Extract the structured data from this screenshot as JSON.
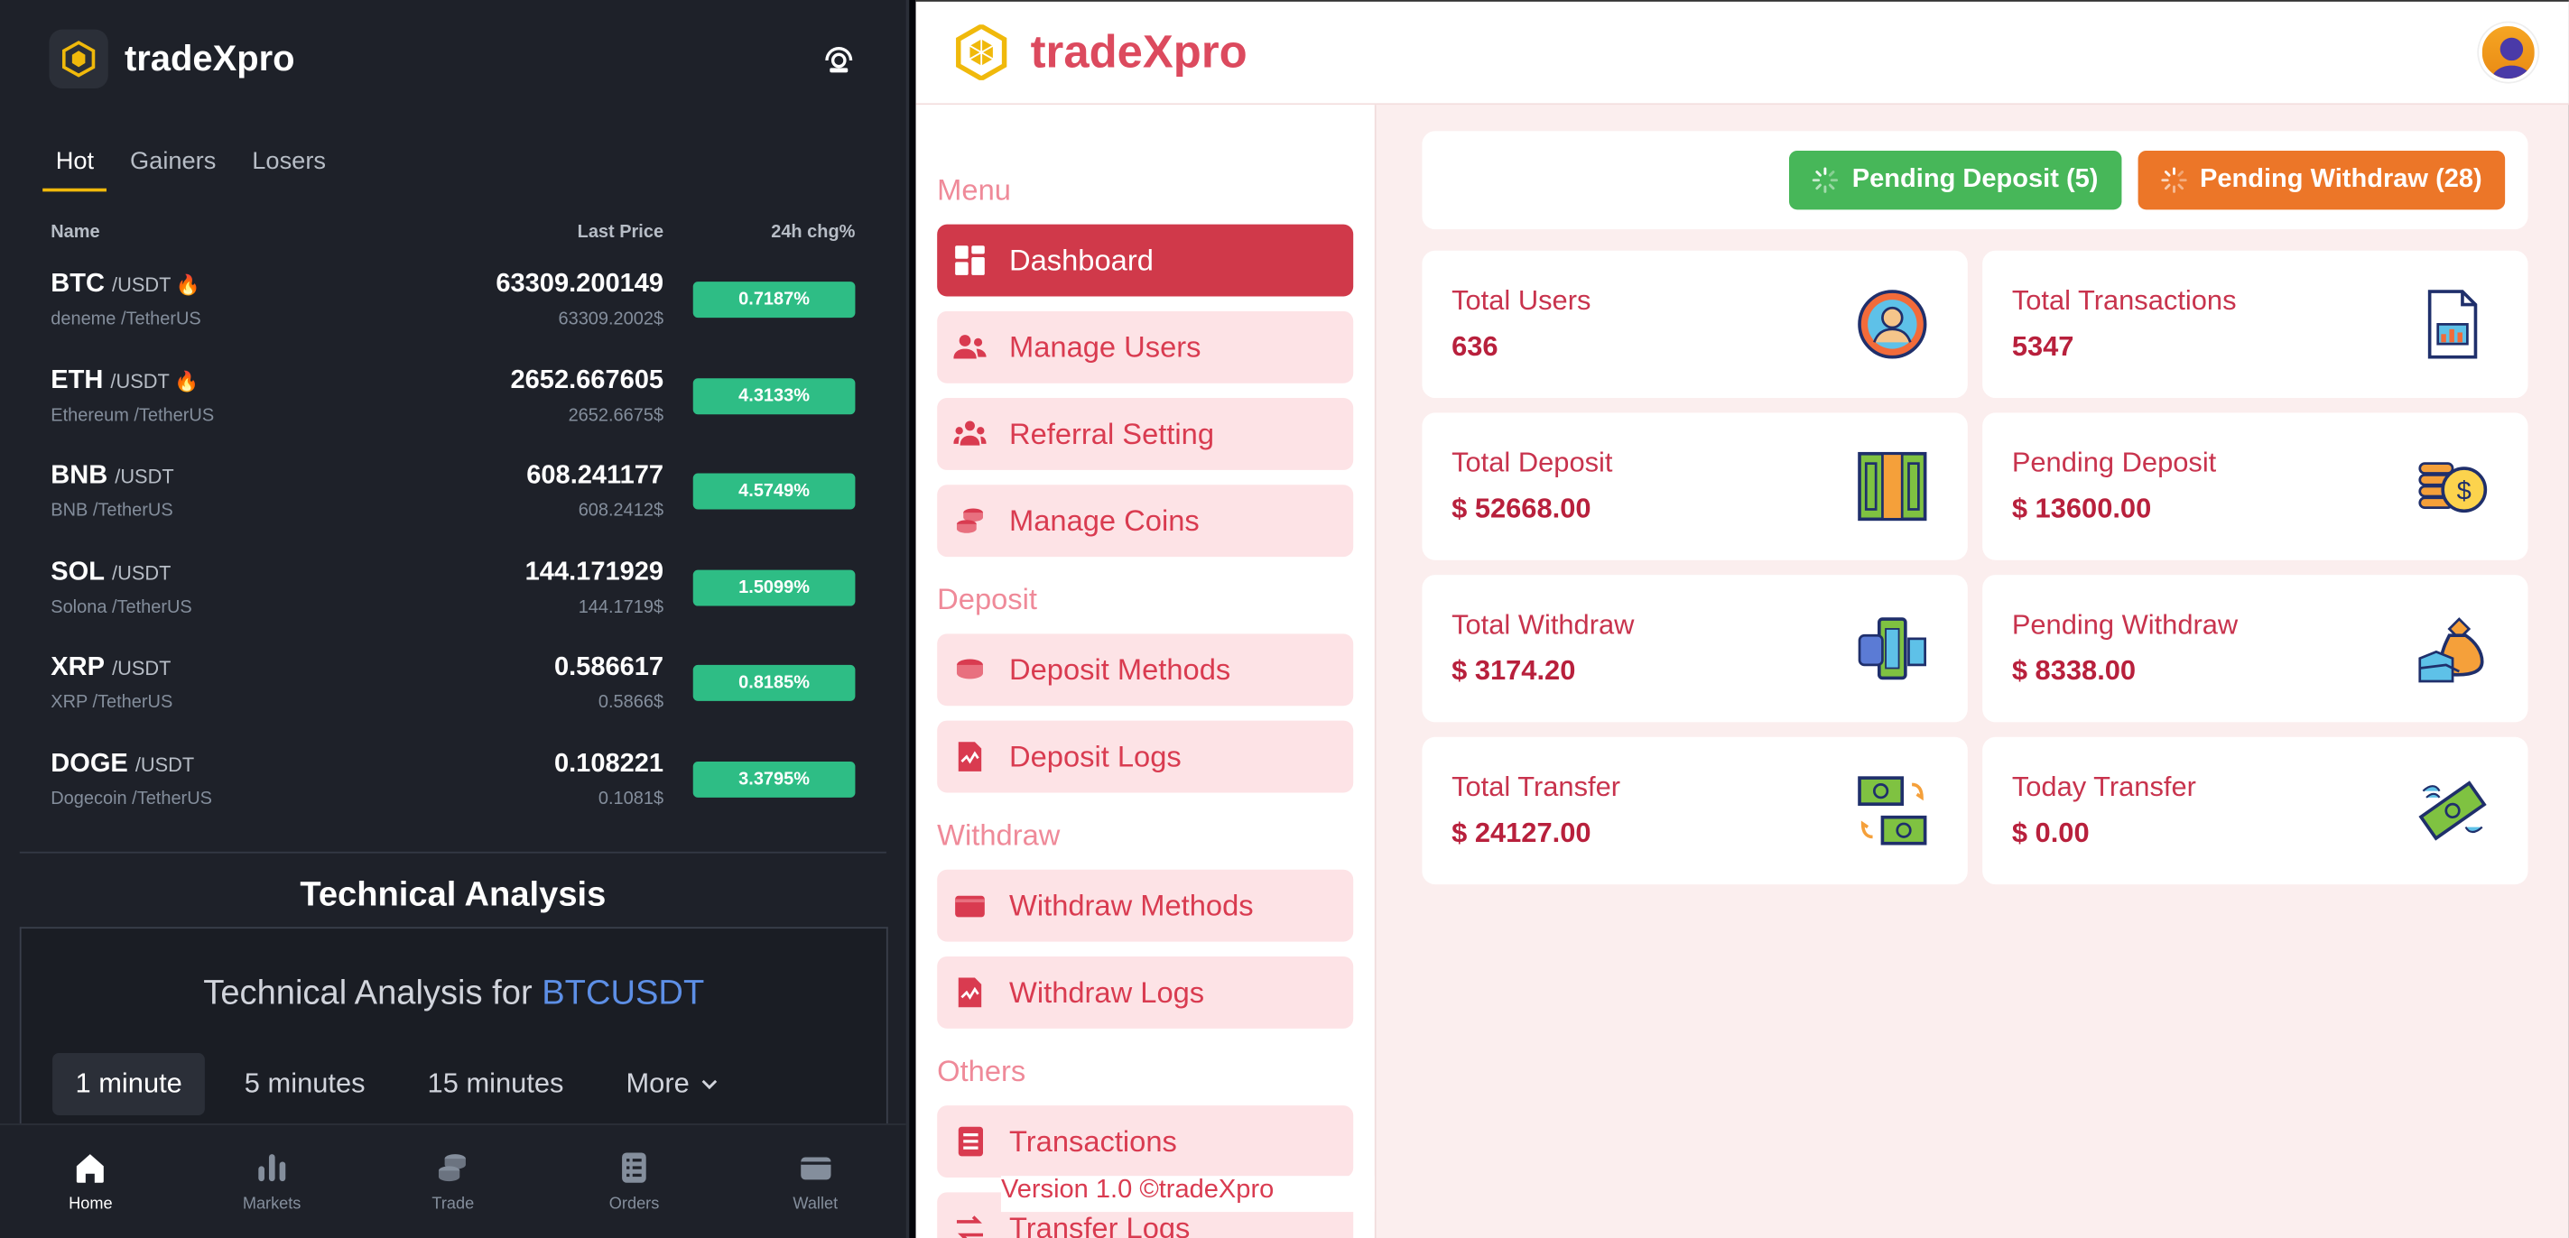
{
  "mobile": {
    "brand": "tradeXpro",
    "tabs": [
      "Hot",
      "Gainers",
      "Losers"
    ],
    "columns": {
      "name": "Name",
      "last_price": "Last Price",
      "change": "24h chg%"
    },
    "coins": [
      {
        "symbol": "BTC",
        "quote": "/USDT",
        "hot": true,
        "subtitle": "deneme /TetherUS",
        "price": "63309.200149",
        "price_sub": "63309.2002$",
        "change": "0.7187%"
      },
      {
        "symbol": "ETH",
        "quote": "/USDT",
        "hot": true,
        "subtitle": "Ethereum /TetherUS",
        "price": "2652.667605",
        "price_sub": "2652.6675$",
        "change": "4.3133%"
      },
      {
        "symbol": "BNB",
        "quote": "/USDT",
        "hot": false,
        "subtitle": "BNB /TetherUS",
        "price": "608.241177",
        "price_sub": "608.2412$",
        "change": "4.5749%"
      },
      {
        "symbol": "SOL",
        "quote": "/USDT",
        "hot": false,
        "subtitle": "Solona /TetherUS",
        "price": "144.171929",
        "price_sub": "144.1719$",
        "change": "1.5099%"
      },
      {
        "symbol": "XRP",
        "quote": "/USDT",
        "hot": false,
        "subtitle": "XRP /TetherUS",
        "price": "0.586617",
        "price_sub": "0.5866$",
        "change": "0.8185%"
      },
      {
        "symbol": "DOGE",
        "quote": "/USDT",
        "hot": false,
        "subtitle": "Dogecoin /TetherUS",
        "price": "0.108221",
        "price_sub": "0.1081$",
        "change": "3.3795%"
      }
    ],
    "technical_analysis": {
      "section_title": "Technical Analysis",
      "heading_prefix": "Technical Analysis for ",
      "pair": "BTCUSDT",
      "intervals": [
        "1 minute",
        "5 minutes",
        "15 minutes"
      ],
      "more": "More"
    },
    "bottom_nav": [
      "Home",
      "Markets",
      "Trade",
      "Orders",
      "Wallet"
    ]
  },
  "admin": {
    "brand": "tradeXpro",
    "sections": {
      "menu": "Menu",
      "deposit": "Deposit",
      "withdraw": "Withdraw",
      "others": "Others"
    },
    "menu": {
      "dashboard": "Dashboard",
      "manage_users": "Manage Users",
      "referral": "Referral Setting",
      "manage_coins": "Manage Coins",
      "deposit_methods": "Deposit Methods",
      "deposit_logs": "Deposit Logs",
      "withdraw_methods": "Withdraw Methods",
      "withdraw_logs": "Withdraw Logs",
      "transactions": "Transactions",
      "transfer_logs": "Transfer Logs"
    },
    "version": "Version 1.0 ©tradeXpro",
    "pending_deposit_btn": "Pending Deposit (5)",
    "pending_withdraw_btn": "Pending Withdraw (28)",
    "cards": [
      {
        "label": "Total Users",
        "value": "636",
        "icon": "user-icon"
      },
      {
        "label": "Total Transactions",
        "value": "5347",
        "icon": "report-icon"
      },
      {
        "label": "Total Deposit",
        "value": "$ 52668.00",
        "icon": "cash-icon"
      },
      {
        "label": "Pending Deposit",
        "value": "$ 13600.00",
        "icon": "coins-icon"
      },
      {
        "label": "Total Withdraw",
        "value": "$ 3174.20",
        "icon": "withdraw-icon"
      },
      {
        "label": "Pending Withdraw",
        "value": "$ 8338.00",
        "icon": "money-bag-icon"
      },
      {
        "label": "Total Transfer",
        "value": "$ 24127.00",
        "icon": "transfer-icon"
      },
      {
        "label": "Today Transfer",
        "value": "$ 0.00",
        "icon": "flying-money-icon"
      }
    ],
    "colors": {
      "accent": "#d0394a",
      "pending_deposit": "#47b759",
      "pending_withdraw": "#ec7628"
    }
  }
}
